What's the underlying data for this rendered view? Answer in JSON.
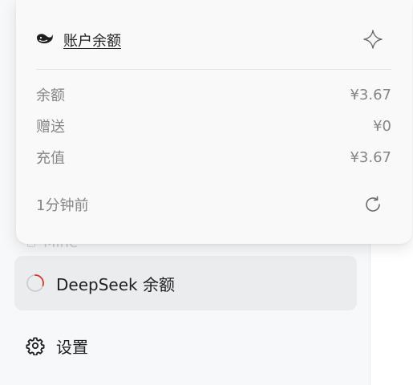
{
  "popup": {
    "title": "账户余额",
    "icons": {
      "brand": "whale-icon",
      "pin": "sparkle-icon",
      "refresh": "refresh-icon"
    },
    "rows": [
      {
        "label": "余额",
        "value": "¥3.67"
      },
      {
        "label": "赠送",
        "value": "¥0"
      },
      {
        "label": "充值",
        "value": "¥3.67"
      }
    ],
    "updated": "1分钟前"
  },
  "sidebar": {
    "peek_label": "Mine",
    "items": [
      {
        "label": "DeepSeek 余额",
        "icon": "loading-spinner-icon",
        "active": true
      },
      {
        "label": "设置",
        "icon": "gear-icon",
        "active": false
      }
    ]
  },
  "colors": {
    "accent_spinner": "#d9342b",
    "muted_text": "#858585",
    "active_bg": "#ebecee"
  }
}
